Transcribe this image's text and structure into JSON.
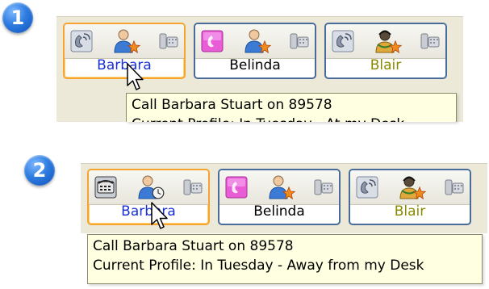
{
  "steps": [
    {
      "badge": "1",
      "contacts": [
        {
          "name": "Barbara",
          "name_color": "#1a2fd6",
          "device": "handset-icon",
          "status": "available-star-icon",
          "selected": true
        },
        {
          "name": "Belinda",
          "name_color": "#000000",
          "device": "mobile-pink-icon",
          "status": "available-star-icon",
          "selected": false
        },
        {
          "name": "Blair",
          "name_color": "#8a8a00",
          "device": "handset-icon",
          "status": "headset-star-icon",
          "selected": false
        }
      ],
      "tooltip": {
        "line1": "Call Barbara Stuart on 89578",
        "line2": "Current Profile: In Tuesday - At my Desk"
      }
    },
    {
      "badge": "2",
      "contacts": [
        {
          "name": "Barbara",
          "name_color": "#1a2fd6",
          "device": "desk-phone-icon",
          "status": "away-clock-icon",
          "selected": true
        },
        {
          "name": "Belinda",
          "name_color": "#000000",
          "device": "mobile-pink-icon",
          "status": "available-star-icon",
          "selected": false
        },
        {
          "name": "Blair",
          "name_color": "#8a8a00",
          "device": "handset-icon",
          "status": "headset-star-icon",
          "selected": false
        }
      ],
      "tooltip": {
        "line1": "Call Barbara Stuart on 89578",
        "line2": "Current Profile: In Tuesday - Away from my Desk"
      }
    }
  ],
  "colors": {
    "badge": "#2f7de0",
    "selected_border": "#f6a32f",
    "card_border": "#496b9a",
    "tooltip_bg": "#ffffe1"
  }
}
